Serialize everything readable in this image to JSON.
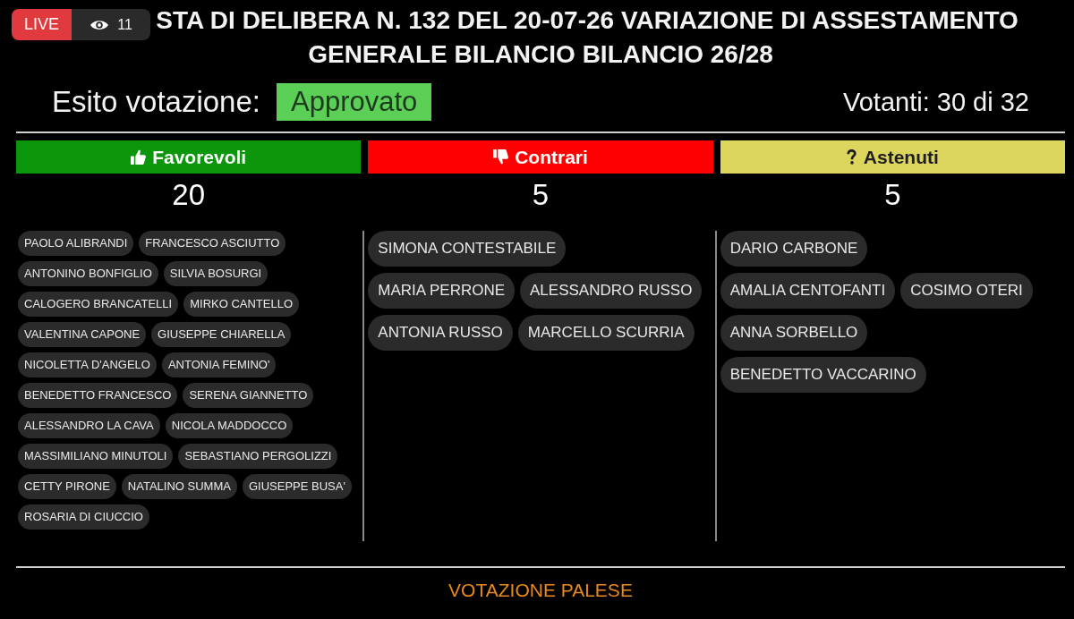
{
  "live_indicator": {
    "label": "LIVE",
    "viewers": "11"
  },
  "title": "STA DI DELIBERA N. 132 DEL 20-07-26 VARIAZIONE DI ASSESTAMENTO GENERALE BILANCIO BILANCIO 26/28",
  "result": {
    "label": "Esito votazione:",
    "outcome": "Approvato",
    "voters": "Votanti: 30 di 32"
  },
  "columns": [
    {
      "kind": "favour",
      "label": "Favorevoli",
      "color": "#0b960b",
      "count": "20",
      "rows": [
        [
          "PAOLO ALIBRANDI",
          "FRANCESCO ASCIUTTO"
        ],
        [
          "ANTONINO BONFIGLIO",
          "SILVIA BOSURGI"
        ],
        [
          "CALOGERO BRANCATELLI",
          "MIRKO CANTELLO"
        ],
        [
          "VALENTINA CAPONE",
          "GIUSEPPE CHIARELLA"
        ],
        [
          "NICOLETTA D'ANGELO",
          "ANTONIA FEMINO'"
        ],
        [
          "BENEDETTO FRANCESCO",
          "SERENA GIANNETTO"
        ],
        [
          "ALESSANDRO LA CAVA",
          "NICOLA MADDOCCO"
        ],
        [
          "MASSIMILIANO MINUTOLI",
          "SEBASTIANO PERGOLIZZI"
        ],
        [
          "CETTY PIRONE",
          "NATALINO SUMMA",
          "GIUSEPPE BUSA'"
        ],
        [
          "ROSARIA DI CIUCCIO"
        ]
      ]
    },
    {
      "kind": "against",
      "label": "Contrari",
      "color": "#ff0000",
      "count": "5",
      "rows": [
        [
          "SIMONA CONTESTABILE"
        ],
        [
          "MARIA PERRONE",
          "ALESSANDRO RUSSO"
        ],
        [
          "ANTONIA RUSSO",
          "MARCELLO SCURRIA"
        ]
      ]
    },
    {
      "kind": "abstain",
      "label": "Astenuti",
      "color": "#dcd65f",
      "count": "5",
      "rows": [
        [
          "DARIO CARBONE"
        ],
        [
          "AMALIA CENTOFANTI",
          "COSIMO OTERI"
        ],
        [
          "ANNA SORBELLO"
        ],
        [
          "BENEDETTO VACCARINO"
        ]
      ]
    }
  ],
  "footer": "VOTAZIONE PALESE"
}
